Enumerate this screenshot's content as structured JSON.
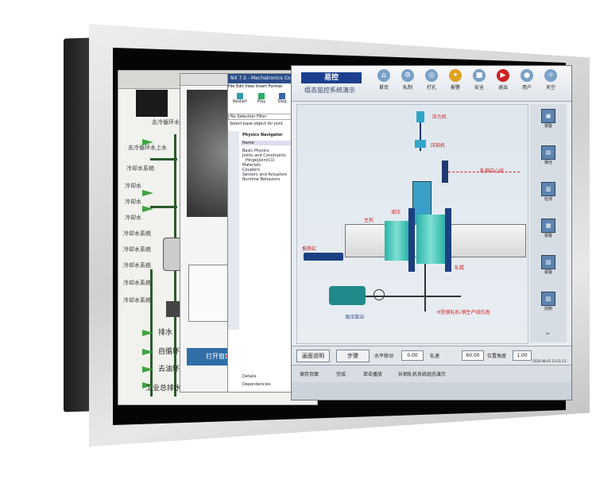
{
  "win1": {
    "tags": [
      "去冷循环水上",
      "去冷循环水上水",
      "冷却水系统",
      "冷却水",
      "冷却水",
      "冷却水",
      "冷却水系统",
      "冷却水系统",
      "冷却水系统",
      "冷却水系统",
      "冷却水系统"
    ],
    "bottom_labels": [
      "排水",
      "自循环水",
      "去油环境",
      "工业总排水"
    ]
  },
  "win2": {
    "button_label": "打开窗口"
  },
  "win3": {
    "title": "NX 7.5 - Mechatronics Concept",
    "menu": [
      "File",
      "Edit",
      "View",
      "Insert",
      "Format"
    ],
    "toolbar": [
      "Restart",
      "Play",
      "Step"
    ],
    "filter_label": "No Selection Filter",
    "prompt": "Select base object for joint",
    "navigator_title": "Physics Navigator",
    "column": "Name",
    "tree": [
      "Basic Physics",
      "Joints and Constraints",
      "Hinge(Joint)(1)",
      "Materials",
      "Couplers",
      "Sensors and Actuators",
      "Runtime Behaviors"
    ],
    "footer": [
      "Details",
      "Dependencies"
    ]
  },
  "win4": {
    "logo": "易控",
    "subtitle": "组态监控系统演示",
    "toolbar": [
      {
        "label": "首页",
        "icon": "home-icon"
      },
      {
        "label": "轧制",
        "icon": "gear-icon"
      },
      {
        "label": "打孔",
        "icon": "drill-icon"
      },
      {
        "label": "报警",
        "icon": "bell-icon"
      },
      {
        "label": "安全",
        "icon": "lock-icon"
      },
      {
        "label": "退出",
        "icon": "exit-icon"
      },
      {
        "label": "用户",
        "icon": "user-icon"
      },
      {
        "label": "天空",
        "icon": "sky-icon"
      }
    ],
    "diagram_labels": {
      "top": "压力机",
      "mid": "压陷机",
      "right": "轧钢中心线",
      "left1": "主机",
      "left2": "推移缸",
      "c1": "液压",
      "c2": "轧辊",
      "pump": "液压泵站",
      "note": "H型钢轧机-钢生产线仿真"
    },
    "rail": [
      "报警",
      "钢坯",
      "检测",
      "报警",
      "报警",
      "控制"
    ],
    "bar1": {
      "mode_label": "画面说明",
      "step_label": "步骤",
      "horiz_label": "水平移动",
      "horiz_val": "0.00",
      "speed_label": "轧速",
      "speed_val": "60.00",
      "angle_label": "位置角度",
      "angle_val": "1.00",
      "date": "2020-08-01 13:51:13"
    },
    "bar2": {
      "save": "保存页面",
      "done": "完成",
      "play": "单击播放",
      "status": "长钢轧机系统组态演示"
    }
  }
}
